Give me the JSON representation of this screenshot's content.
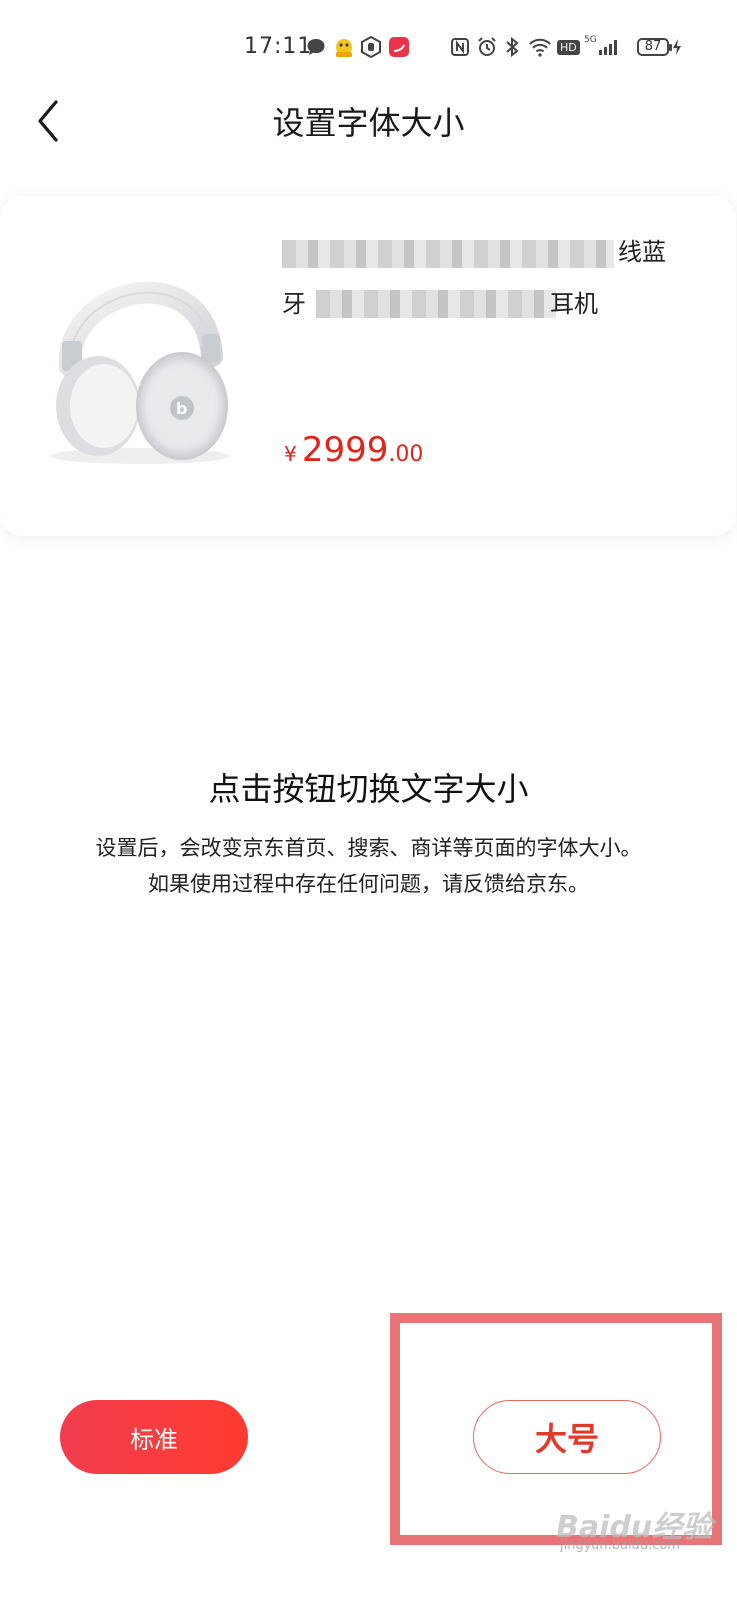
{
  "status_bar": {
    "time": "17:11",
    "icons": [
      "chat-icon",
      "app-mascot-icon",
      "hand-icon",
      "app-swan-icon",
      "nfc-icon",
      "alarm-icon",
      "bluetooth-icon",
      "wifi-icon",
      "hd-icon",
      "signal-5g-icon"
    ],
    "hd_label": "HD",
    "net_label": "5G",
    "battery": "87"
  },
  "header": {
    "back_icon": "chevron-left-icon",
    "title": "设置字体大小"
  },
  "product": {
    "name_line1_visible": "线蓝",
    "name_line2_prefix": "牙",
    "name_line2_visible": "耳机",
    "price_symbol": "¥",
    "price_integer": "2999",
    "price_decimal": ".00",
    "price_color": "#e2231a",
    "image": "headphones-image"
  },
  "instructions": {
    "title": "点击按钮切换文字大小",
    "line1": "设置后，会改变京东首页、搜索、商详等页面的字体大小。",
    "line2": "如果使用过程中存在任何问题，请反馈给京东。"
  },
  "buttons": {
    "standard": "标准",
    "large": "大号",
    "accent": "#f23d4f"
  },
  "watermark": {
    "brand": "Baidu经验",
    "url": "jingyan.baidu.com"
  }
}
